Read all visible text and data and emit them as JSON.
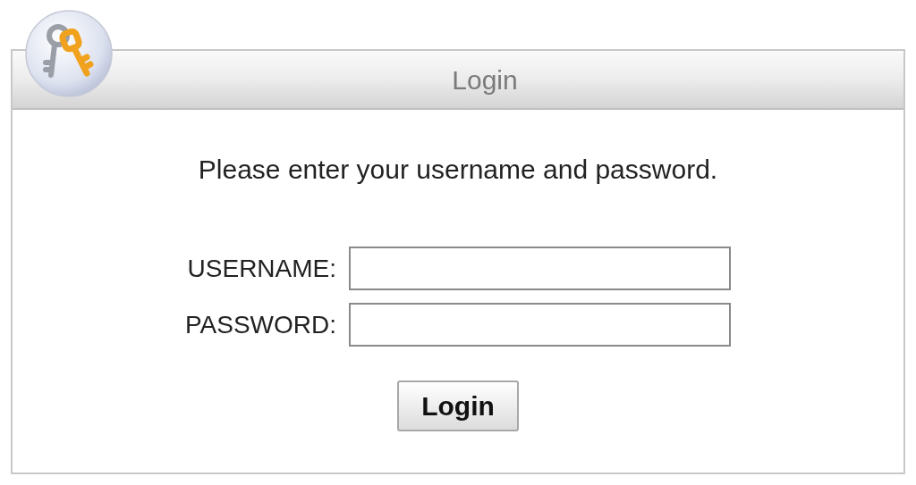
{
  "dialog": {
    "title": "Login"
  },
  "message": "Please enter your username and password.",
  "fields": [
    {
      "label": "USERNAME:"
    },
    {
      "label": "PASSWORD:"
    }
  ],
  "submit_button": "Login"
}
